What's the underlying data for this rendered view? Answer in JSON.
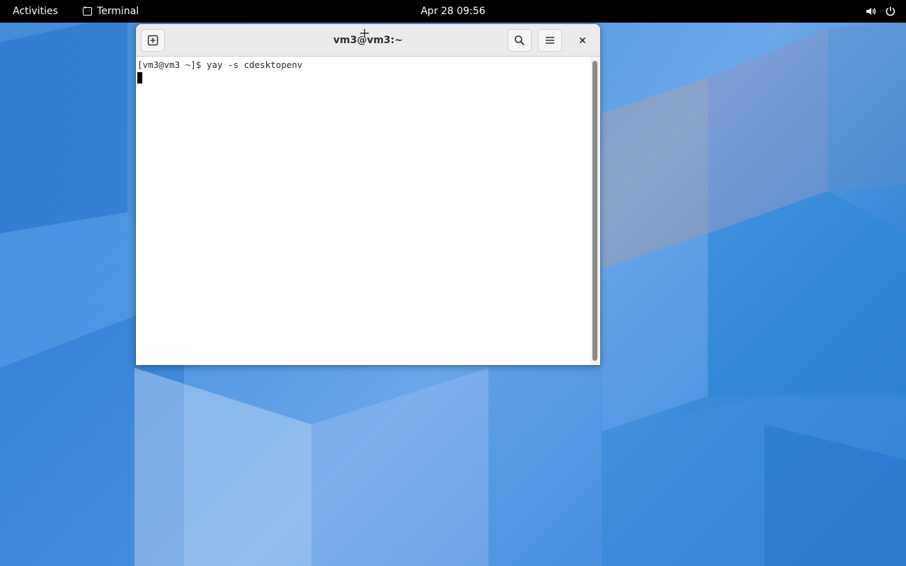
{
  "topbar": {
    "activities": "Activities",
    "app_name": "Terminal",
    "clock": "Apr 28  09:56",
    "icons": [
      "volume-icon",
      "power-icon"
    ]
  },
  "terminal": {
    "title": "vm3@vm3:~",
    "prompt_line": "[vm3@vm3 ~]$ yay -s cdesktopenv",
    "buttons": [
      "new-tab-icon",
      "search-icon",
      "hamburger-menu-icon",
      "close-icon"
    ]
  },
  "colors": {
    "topbar_bg": "#000000",
    "headerbar_bg": "#ebebeb",
    "terminal_bg": "#ffffff",
    "wallpaper_accent": "#3a86d8"
  }
}
